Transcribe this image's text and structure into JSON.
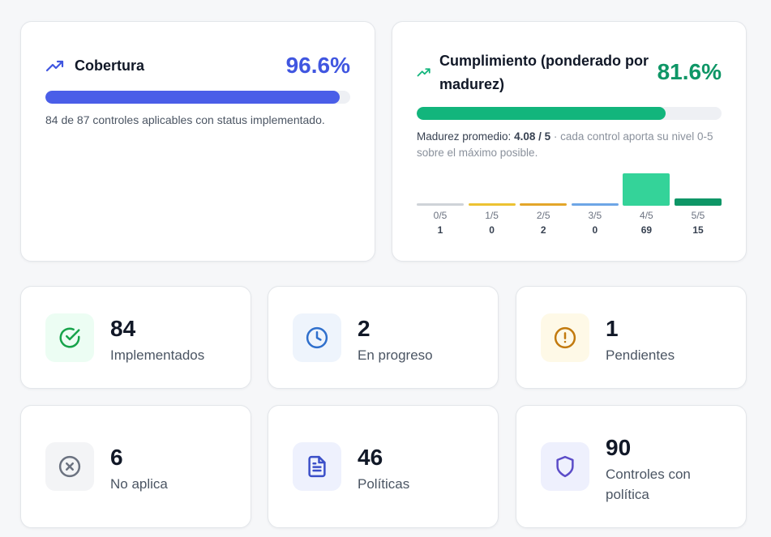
{
  "coverage": {
    "title": "Cobertura",
    "percent_text": "96.6%",
    "fill_percent": 96.6,
    "description": "84 de 87 controles aplicables con status implementado.",
    "icon": "trending-up-icon",
    "color": "#4056e0"
  },
  "compliance": {
    "title": "Cumplimiento (ponderado por madurez)",
    "percent_text": "81.6%",
    "fill_percent": 81.6,
    "maturity_prefix": "Madurez promedio: ",
    "maturity_value": "4.08 / 5",
    "maturity_sep": " · ",
    "maturity_note": "cada control aporta su nivel 0-5 sobre el máximo posible.",
    "icon": "trending-up-icon",
    "color": "#0e9666",
    "histogram": [
      {
        "label": "0/5",
        "count": "1",
        "value": 1,
        "color": "#cfd3d8"
      },
      {
        "label": "1/5",
        "count": "0",
        "value": 0,
        "color": "#ecc232"
      },
      {
        "label": "2/5",
        "count": "2",
        "value": 2,
        "color": "#e3a62a"
      },
      {
        "label": "3/5",
        "count": "0",
        "value": 0,
        "color": "#6ea6e6"
      },
      {
        "label": "4/5",
        "count": "69",
        "value": 69,
        "color": "#34d399"
      },
      {
        "label": "5/5",
        "count": "15",
        "value": 15,
        "color": "#0e9666"
      }
    ]
  },
  "stats": [
    {
      "value": "84",
      "label": "Implementados",
      "icon": "check-circle-icon",
      "color": "#16a34a",
      "bg": "#ecfdf3"
    },
    {
      "value": "2",
      "label": "En progreso",
      "icon": "clock-icon",
      "color": "#2f6fcc",
      "bg": "#eef4fc"
    },
    {
      "value": "1",
      "label": "Pendientes",
      "icon": "alert-circle-icon",
      "color": "#c27a0e",
      "bg": "#fef9e7"
    },
    {
      "value": "6",
      "label": "No aplica",
      "icon": "x-circle-icon",
      "color": "#6b7280",
      "bg": "#f3f4f6"
    },
    {
      "value": "46",
      "label": "Políticas",
      "icon": "document-icon",
      "color": "#3b4fc8",
      "bg": "#eef1fd"
    },
    {
      "value": "90",
      "label": "Controles con política",
      "icon": "shield-icon",
      "color": "#5b4cc8",
      "bg": "#eef0fd"
    }
  ]
}
